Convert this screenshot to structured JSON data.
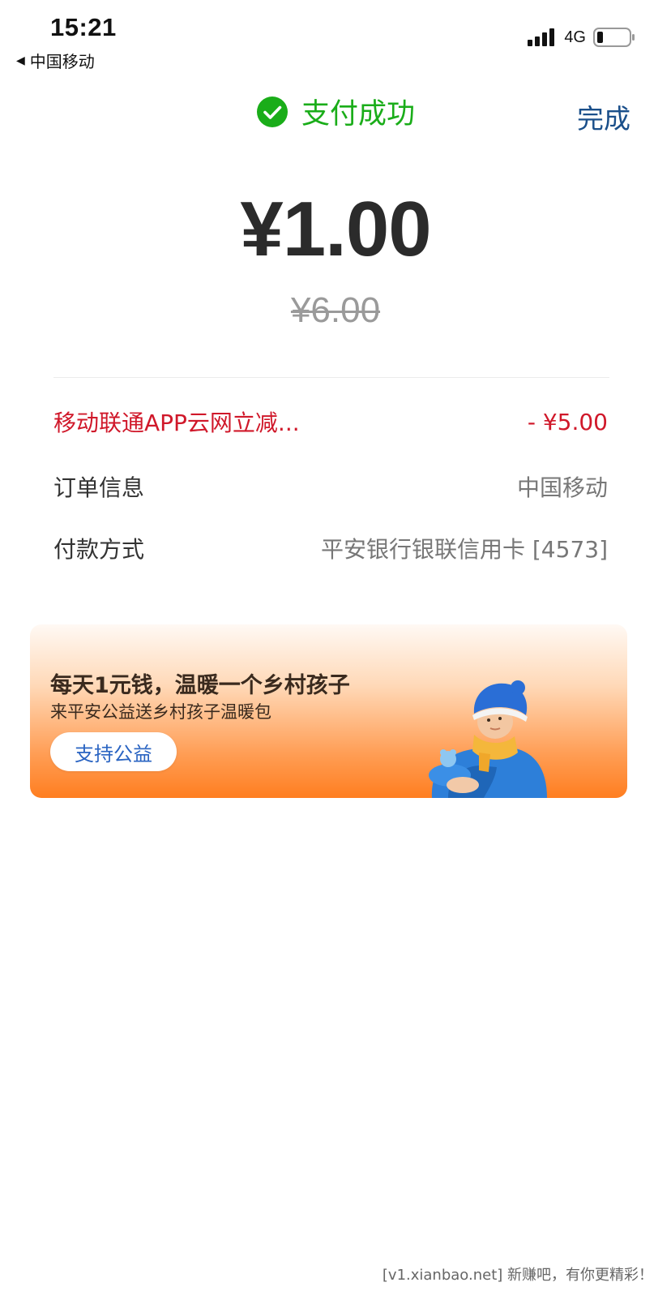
{
  "status_bar": {
    "time": "15:21",
    "back_label": "中国移动",
    "network": "4G"
  },
  "header": {
    "title": "支付成功",
    "done_label": "完成",
    "success_color": "#1aad19"
  },
  "payment": {
    "amount": "¥1.00",
    "original_amount": "¥6.00"
  },
  "details": {
    "discount": {
      "label": "移动联通APP云网立减...",
      "value": "- ¥5.00"
    },
    "order": {
      "label": "订单信息",
      "value": "中国移动"
    },
    "method": {
      "label": "付款方式",
      "value": "平安银行银联信用卡 [4573]"
    }
  },
  "banner": {
    "title": "每天1元钱，温暖一个乡村孩子",
    "subtitle": "来平安公益送乡村孩子温暖包",
    "button_label": "支持公益"
  },
  "watermark": "[v1.xianbao.net] 新赚吧，有你更精彩！",
  "icons": [
    "back-arrow-icon",
    "signal-icon",
    "battery-icon",
    "check-circle-icon",
    "child-illustration"
  ]
}
